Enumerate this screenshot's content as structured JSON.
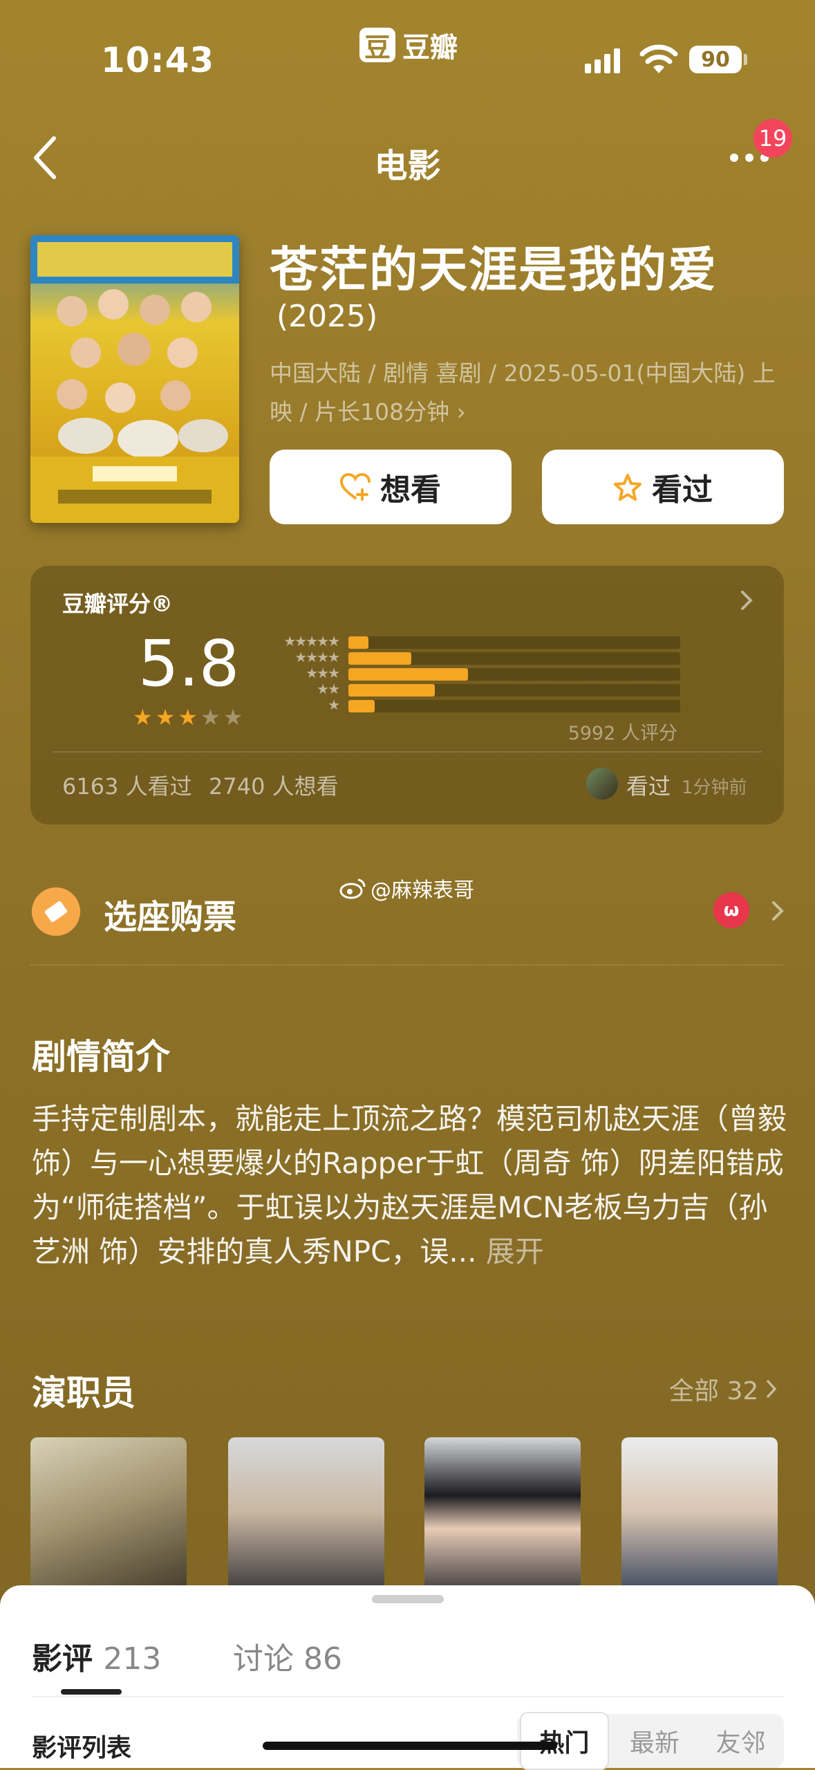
{
  "status_bar": {
    "time": "10:43",
    "app_logo_char": "豆",
    "app_logo_text": "豆瓣",
    "battery": "90"
  },
  "nav": {
    "title": "电影",
    "badge_count": "19"
  },
  "movie": {
    "title": "苍茫的天涯是我的爱",
    "year": "(2025)",
    "meta": "中国大陆 / 剧情 喜剧 / 2025-05-01(中国大陆) 上映 / 片长108分钟 ›",
    "want_label": "想看",
    "seen_label": "看过"
  },
  "rating": {
    "label": "豆瓣评分®",
    "score": "5.8",
    "star_value": 3,
    "distribution_percent": {
      "5": 6,
      "4": 19,
      "3": 36,
      "2": 26,
      "1": 8
    },
    "count_text": "5992 人评分",
    "seen_count": "6163 人看过",
    "want_count": "2740 人想看",
    "activity_label": "看过",
    "activity_time": "1分钟前"
  },
  "ticket": {
    "label": "选座购票",
    "cat_icon_text": "ω"
  },
  "watermark": {
    "text": "@麻辣表哥"
  },
  "synopsis": {
    "title": "剧情简介",
    "text": "手持定制剧本，就能走上顶流之路？模范司机赵天涯（曾毅 饰）与一心想要爆火的Rapper于虹（周奇 饰）阴差阳错成为“师徒搭档”。于虹误以为赵天涯是MCN老板乌力吉（孙艺洲 饰）安排的真人秀NPC，误...",
    "expand": "展开"
  },
  "cast": {
    "title": "演职员",
    "all_label": "全部 32"
  },
  "sheet": {
    "tab_reviews": "影评",
    "tab_reviews_count": "213",
    "tab_discuss": "讨论 86",
    "list_label": "影评列表",
    "segments": [
      "热门",
      "最新",
      "友邻"
    ]
  },
  "colors": {
    "accent": "#f5a623",
    "background": "#a3842e",
    "badge": "#f2455b"
  },
  "icons": [
    "chevron-left-icon",
    "more-icon",
    "heart-plus-icon",
    "star-outline-icon",
    "ticket-icon",
    "maoyan-cat-icon",
    "weibo-icon",
    "wifi-icon",
    "signal-icon",
    "battery-icon"
  ]
}
